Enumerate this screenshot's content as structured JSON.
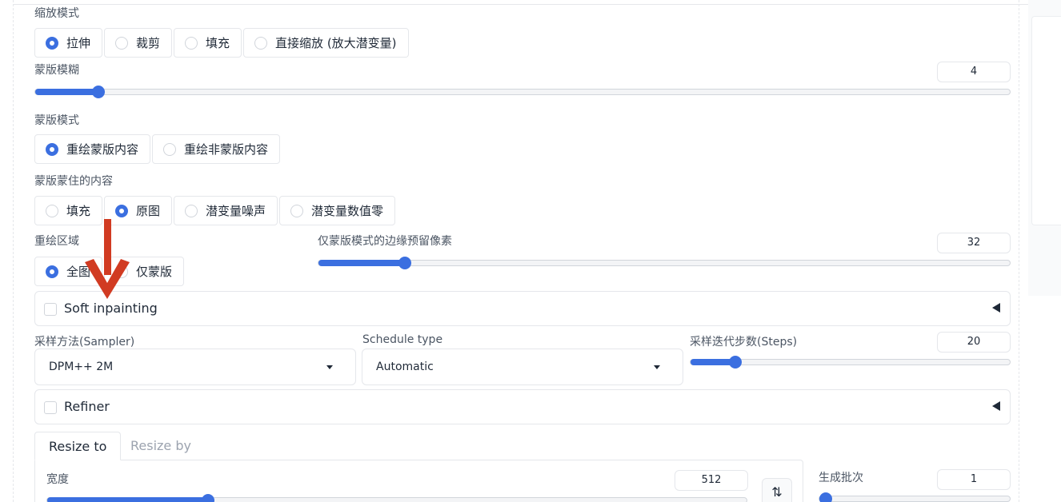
{
  "resize_mode": {
    "label": "缩放模式",
    "options": [
      "拉伸",
      "裁剪",
      "填充",
      "直接缩放 (放大潜变量)"
    ],
    "selected": 0
  },
  "mask_blur": {
    "label": "蒙版模糊",
    "value": "4",
    "fraction": 0.065
  },
  "mask_mode": {
    "label": "蒙版模式",
    "options": [
      "重绘蒙版内容",
      "重绘非蒙版内容"
    ],
    "selected": 0
  },
  "masked_content": {
    "label": "蒙版蒙住的内容",
    "options": [
      "填充",
      "原图",
      "潜变量噪声",
      "潜变量数值零"
    ],
    "selected": 1
  },
  "inpaint_area": {
    "label": "重绘区域",
    "options": [
      "全图",
      "仅蒙版"
    ],
    "selected": 0
  },
  "only_masked_padding": {
    "label": "仅蒙版模式的边缘预留像素",
    "value": "32",
    "fraction": 0.125
  },
  "soft_inpainting": {
    "label": "Soft inpainting"
  },
  "sampler": {
    "label": "采样方法(Sampler)",
    "value": "DPM++ 2M"
  },
  "schedule": {
    "label": "Schedule type",
    "value": "Automatic"
  },
  "steps": {
    "label": "采样迭代步数(Steps)",
    "value": "20",
    "fraction": 0.14
  },
  "refiner": {
    "label": "Refiner"
  },
  "size_tabs": {
    "tabs": [
      "Resize to",
      "Resize by"
    ],
    "active": 0
  },
  "width": {
    "label": "宽度",
    "value": "512",
    "fraction": 0.23
  },
  "batch_count": {
    "label": "生成批次",
    "value": "1",
    "fraction": 0.0
  },
  "swap_icon_glyph": "⇅",
  "colors": {
    "accent": "#3b6fe0",
    "arrow": "#d13b22"
  }
}
